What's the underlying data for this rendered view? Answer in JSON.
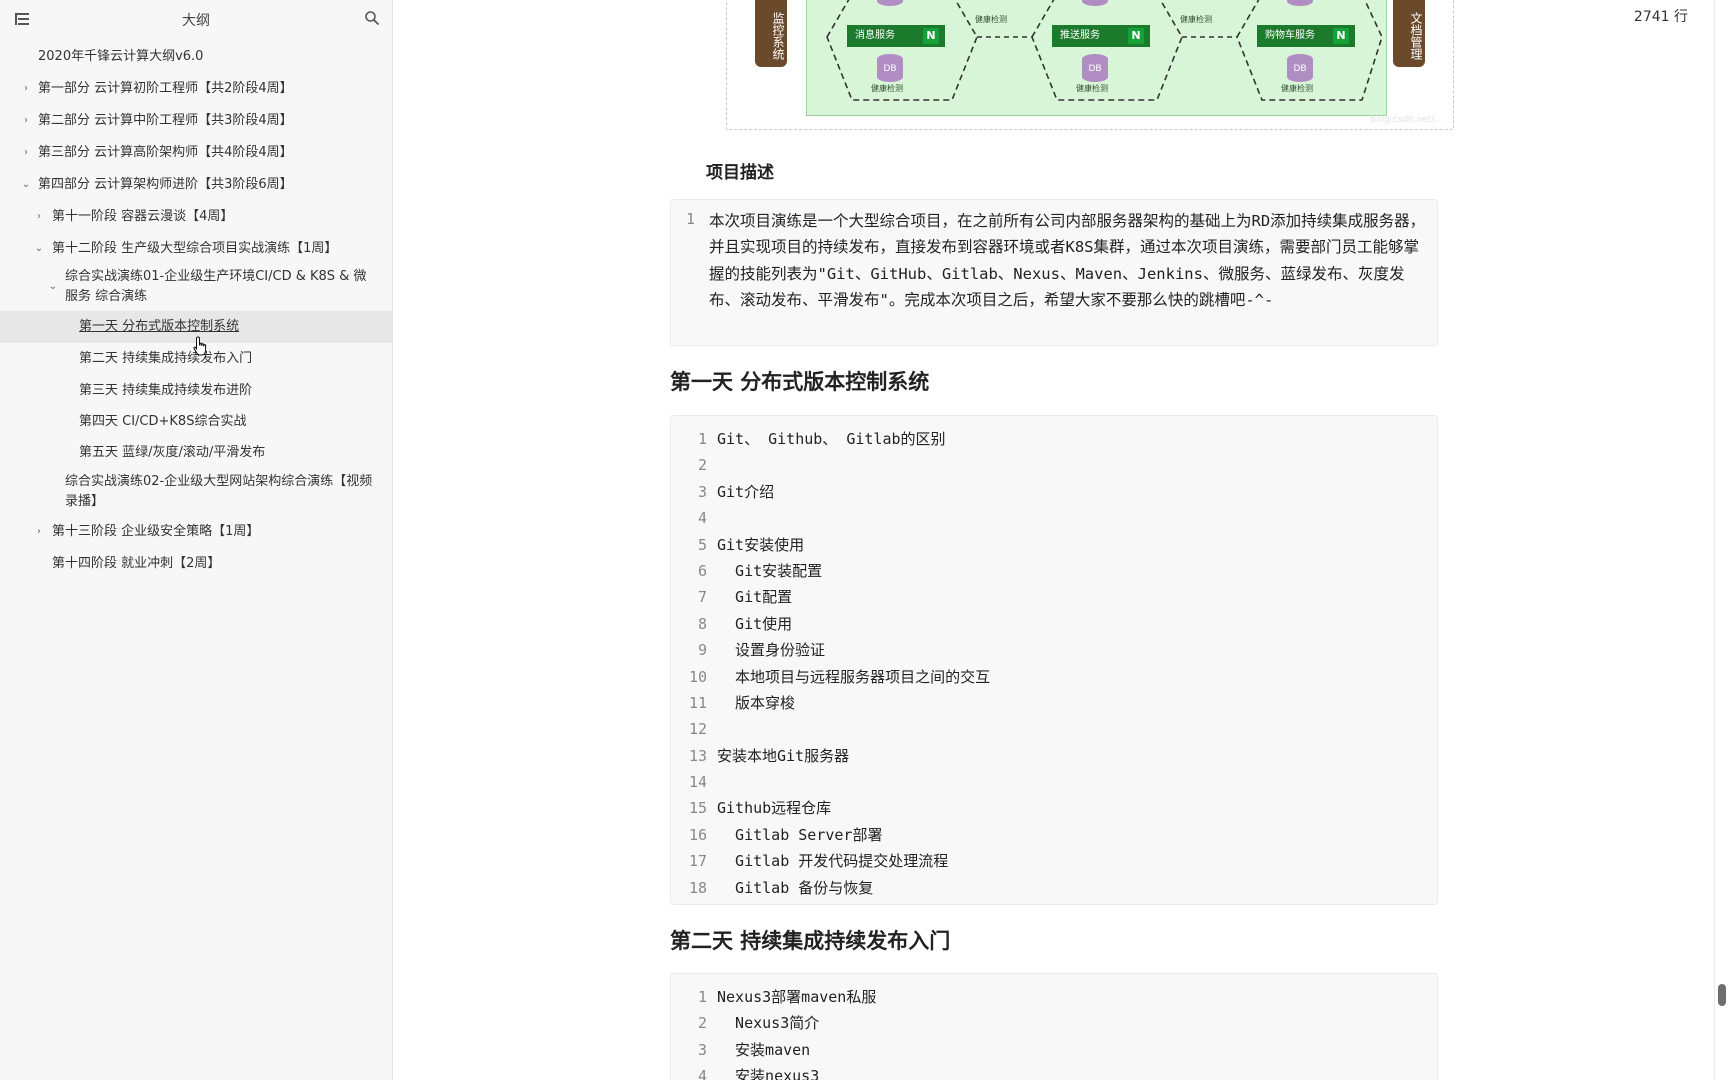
{
  "sidebar": {
    "title": "大纲",
    "items": [
      {
        "label": "2020年千锋云计算大纲v6.0",
        "chevron": ""
      },
      {
        "label": "第一部分 云计算初阶工程师【共2阶段4周】",
        "chevron": "›"
      },
      {
        "label": "第二部分 云计算中阶工程师【共3阶段4周】",
        "chevron": "›"
      },
      {
        "label": "第三部分 云计算高阶架构师【共4阶段4周】",
        "chevron": "›"
      },
      {
        "label": "第四部分 云计算架构师进阶【共3阶段6周】",
        "chevron": "⌄"
      },
      {
        "label": "第十一阶段 容器云漫谈【4周】",
        "chevron": "›"
      },
      {
        "label": "第十二阶段 生产级大型综合项目实战演练【1周】",
        "chevron": "⌄"
      },
      {
        "label": "综合实战演练01-企业级生产环境CI/CD & K8S & 微服务 综合演练",
        "chevron": "⌄"
      },
      {
        "label": "第一天 分布式版本控制系统",
        "chevron": ""
      },
      {
        "label": "第二天 持续集成持续发布入门",
        "chevron": ""
      },
      {
        "label": "第三天 持续集成持续发布进阶",
        "chevron": ""
      },
      {
        "label": "第四天 CI/CD+K8S综合实战",
        "chevron": ""
      },
      {
        "label": "第五天 蓝绿/灰度/滚动/平滑发布",
        "chevron": ""
      },
      {
        "label": "综合实战演练02-企业级大型网站架构综合演练【视频录播】",
        "chevron": ""
      },
      {
        "label": "第十三阶段 企业级安全策略【1周】",
        "chevron": "›"
      },
      {
        "label": "第十四阶段 就业冲刺【2周】",
        "chevron": ""
      }
    ]
  },
  "status": {
    "line_count": "2741 行"
  },
  "diagram": {
    "left_bar": "监控系统",
    "right_bar": "文档管理",
    "services": [
      "消息服务",
      "推送服务",
      "购物车服务"
    ],
    "db_label": "DB",
    "health_label": "健康检测",
    "n_logo": "N",
    "watermark": "blog.csdn.net/..."
  },
  "content": {
    "project_desc_heading": "项目描述",
    "project_desc_line_no": "1",
    "project_desc": "本次项目演练是一个大型综合项目，在之前所有公司内部服务器架构的基础上为RD添加持续集成服务器，并且实现项目的持续发布，直接发布到容器环境或者K8S集群，通过本次项目演练，需要部门员工能够掌握的技能列表为\"Git、GitHub、Gitlab、Nexus、Maven、Jenkins、微服务、蓝绿发布、灰度发布、滚动发布、平滑发布\"。完成本次项目之后，希望大家不要那么快的跳槽吧-^-",
    "day1_heading": "第一天 分布式版本控制系统",
    "day1_lines": [
      {
        "n": "1",
        "t": "Git、 Github、 Gitlab的区别"
      },
      {
        "n": "2",
        "t": ""
      },
      {
        "n": "3",
        "t": "Git介绍"
      },
      {
        "n": "4",
        "t": ""
      },
      {
        "n": "5",
        "t": "Git安装使用"
      },
      {
        "n": "6",
        "t": "  Git安装配置"
      },
      {
        "n": "7",
        "t": "  Git配置"
      },
      {
        "n": "8",
        "t": "  Git使用"
      },
      {
        "n": "9",
        "t": "  设置身份验证"
      },
      {
        "n": "10",
        "t": "  本地项目与远程服务器项目之间的交互"
      },
      {
        "n": "11",
        "t": "  版本穿梭"
      },
      {
        "n": "12",
        "t": ""
      },
      {
        "n": "13",
        "t": "安装本地Git服务器"
      },
      {
        "n": "14",
        "t": ""
      },
      {
        "n": "15",
        "t": "Github远程仓库"
      },
      {
        "n": "16",
        "t": "  Gitlab Server部署"
      },
      {
        "n": "17",
        "t": "  Gitlab 开发代码提交处理流程"
      },
      {
        "n": "18",
        "t": "  Gitlab 备份与恢复"
      }
    ],
    "day2_heading": "第二天 持续集成持续发布入门",
    "day2_lines": [
      {
        "n": "1",
        "t": "Nexus3部署maven私服"
      },
      {
        "n": "2",
        "t": "  Nexus3简介"
      },
      {
        "n": "3",
        "t": "  安装maven"
      },
      {
        "n": "4",
        "t": "  安装nexus3"
      }
    ]
  }
}
